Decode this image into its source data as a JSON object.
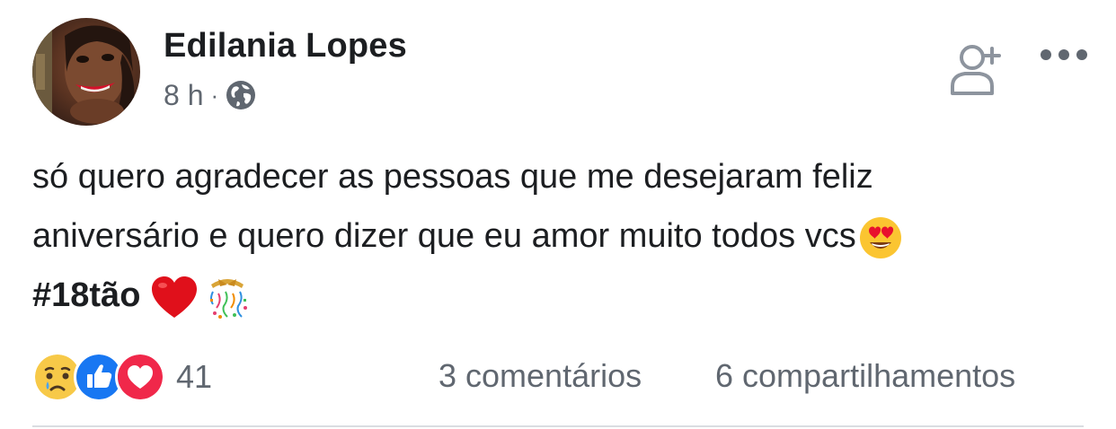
{
  "post": {
    "author": "Edilania Lopes",
    "time": "8 h",
    "separator": "·",
    "privacy_icon": "globe-icon",
    "text_lines": [
      "só quero agradecer as pessoas que me desejaram feliz",
      "aniversário e quero dizer que eu amor muito todos vcs"
    ],
    "hashtag": "#18tão",
    "emojis": [
      "heart-eyes-emoji",
      "red-heart-emoji",
      "confetti-ball-emoji"
    ]
  },
  "actions": {
    "add_friend_icon": "add-friend-icon",
    "more_icon": "more-options-icon"
  },
  "stats": {
    "reactions": [
      "sad-reaction",
      "like-reaction",
      "love-reaction"
    ],
    "reaction_count": "41",
    "comments": "3 comentários",
    "shares": "6 compartilhamentos"
  },
  "colors": {
    "like_blue": "#1877f2",
    "love_red": "#f0284a",
    "sad_yellow": "#f7c948",
    "meta_gray": "#606770",
    "text": "#1c1e21"
  }
}
